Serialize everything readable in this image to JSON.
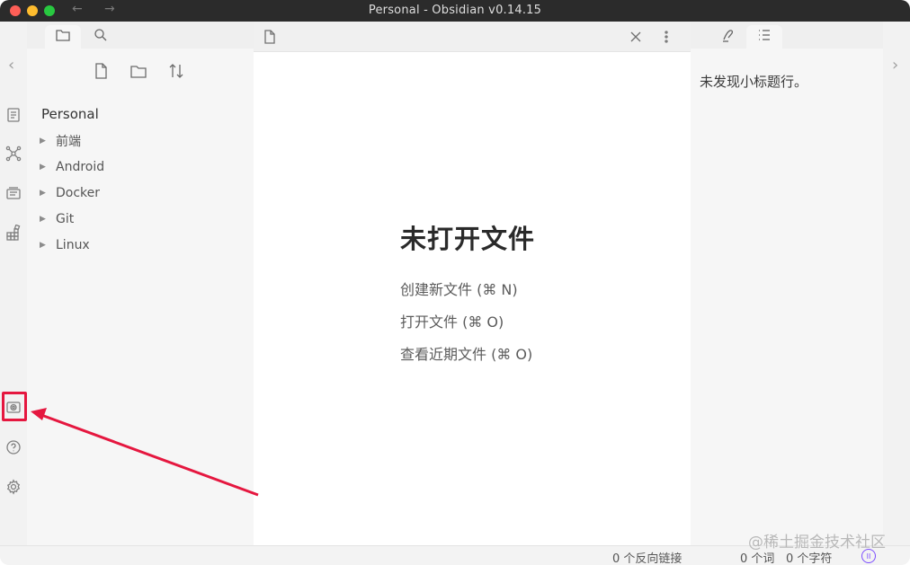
{
  "window": {
    "title": "Personal - Obsidian v0.14.15",
    "back_arrow": "←",
    "forward_arrow": "→"
  },
  "ribbon": {
    "icons": [
      "quick-switcher-icon",
      "graph-view-icon",
      "slides-icon",
      "templates-icon",
      "camera-icon",
      "help-icon",
      "settings-icon"
    ]
  },
  "left_sidebar": {
    "tabs": [
      "folder-icon",
      "search-icon"
    ],
    "actions": [
      "new-note-icon",
      "new-folder-icon",
      "sort-icon"
    ],
    "vault_name": "Personal",
    "folders": [
      {
        "label": "前端"
      },
      {
        "label": "Android"
      },
      {
        "label": "Docker"
      },
      {
        "label": "Git"
      },
      {
        "label": "Linux"
      }
    ]
  },
  "main": {
    "empty_title": "未打开文件",
    "actions": [
      {
        "label": "创建新文件 (⌘ N)"
      },
      {
        "label": "打开文件 (⌘ O)"
      },
      {
        "label": "查看近期文件 (⌘ O)"
      }
    ]
  },
  "right_sidebar": {
    "tabs": [
      "backlinks-icon",
      "outline-icon"
    ],
    "outline_empty": "未发现小标题行。"
  },
  "status": {
    "backlinks": "0 个反向链接",
    "words": "0 个词",
    "chars": "0 个字符"
  },
  "watermark": "@稀土掘金技术社区",
  "colors": {
    "highlight": "#e5173f",
    "titlebar": "#2b2b2b",
    "sync_accent": "#7c4dff"
  }
}
